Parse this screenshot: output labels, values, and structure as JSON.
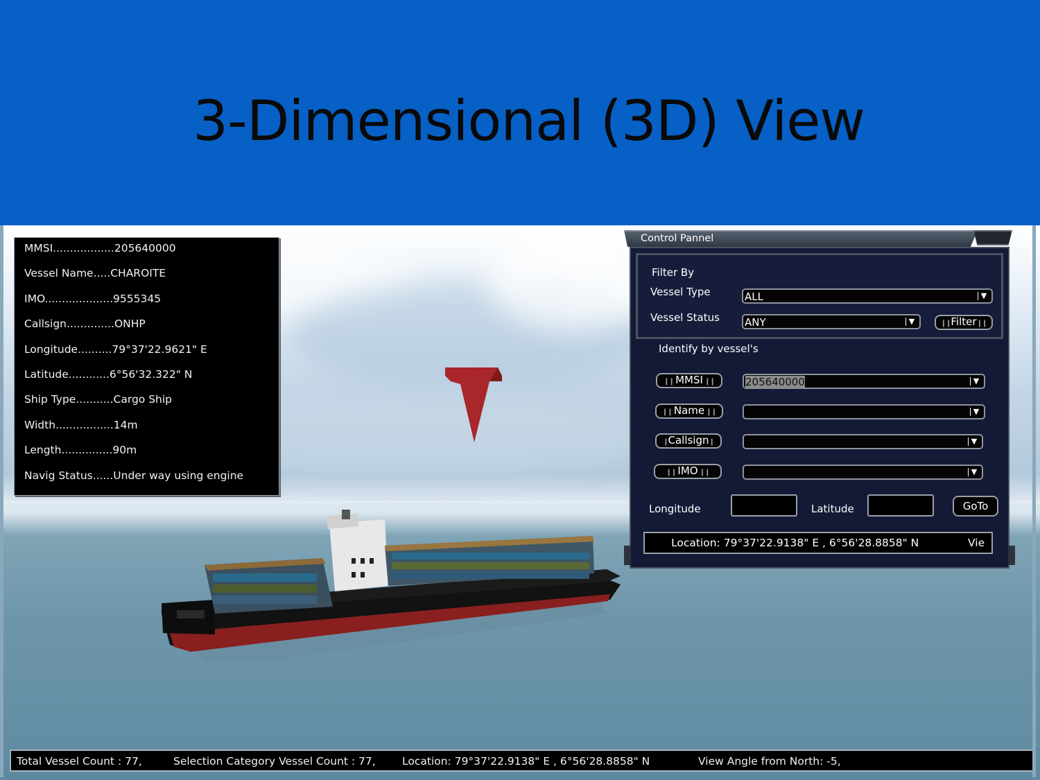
{
  "slide": {
    "title": "3-Dimensional (3D) View"
  },
  "vessel_info": {
    "rows": [
      "MMSI..................205640000",
      "Vessel Name.....CHAROITE",
      "IMO....................9555345",
      "Callsign..............ONHP",
      "Longitude..........79°37'22.9621\" E",
      "Latitude............6°56'32.322\" N",
      "Ship Type...........Cargo Ship",
      "Width.................14m",
      "Length...............90m",
      "Navig Status......Under way using engine"
    ]
  },
  "control_panel": {
    "title": "Control Pannel",
    "filter": {
      "heading": "Filter By",
      "vessel_type_label": "Vessel Type",
      "vessel_type_value": "ALL",
      "vessel_status_label": "Vessel Status",
      "vessel_status_value": "ANY",
      "filter_button": "Filter"
    },
    "identify": {
      "heading": "Identify by vessel's",
      "mmsi_button": "MMSI",
      "mmsi_value": "205640000",
      "name_button": "Name",
      "name_value": "",
      "callsign_button": "Callsign",
      "callsign_value": "",
      "imo_button": "IMO",
      "imo_value": ""
    },
    "goto": {
      "longitude_label": "Longitude",
      "latitude_label": "Latitude",
      "goto_button": "GoTo"
    },
    "location_bar": "Location: 79°37'22.9138\" E  ,  6°56'28.8858\" N",
    "location_bar_tail": "Vie"
  },
  "status_bar": {
    "total": "Total Vessel Count : 77,",
    "selection": "Selection Category Vessel Count : 77,",
    "location": "Location: 79°37'22.9138\" E  ,  6°56'28.8858\" N",
    "angle": "View Angle from North: -5,"
  },
  "colors": {
    "title_band": "#0760c6",
    "panel_bg": "#141a35",
    "marker": "#a9262b",
    "hull_red": "#8a1f1f"
  }
}
